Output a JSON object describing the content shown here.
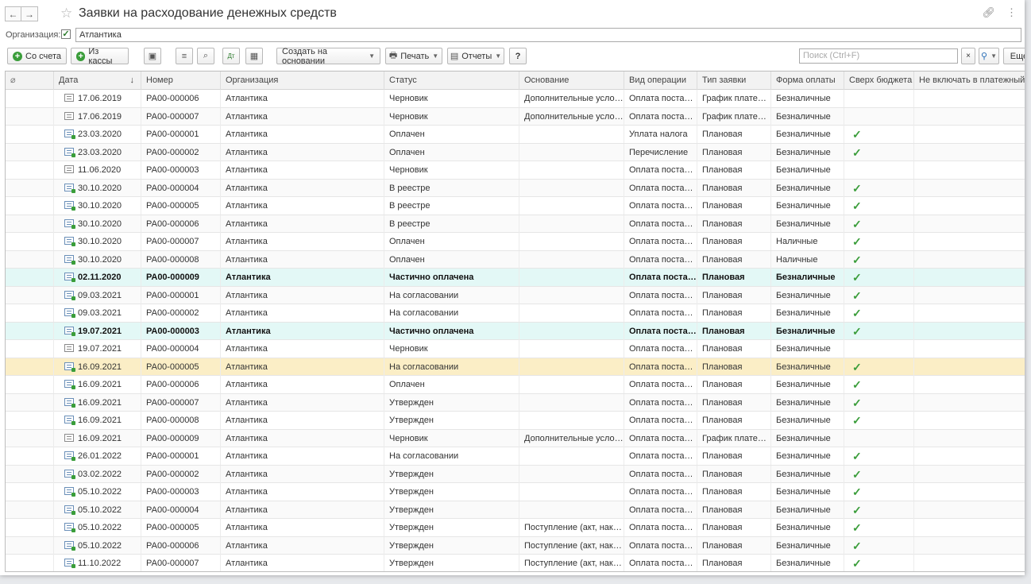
{
  "window": {
    "title": "Заявки на расходование денежных средств"
  },
  "filter": {
    "org_label": "Организация:",
    "org_value": "Атлантика"
  },
  "toolbar": {
    "from_account": "Со счета",
    "from_cash": "Из кассы",
    "create_based": "Создать на основании",
    "print": "Печать",
    "reports": "Отчеты",
    "help": "?",
    "search_placeholder": "Поиск (Ctrl+F)",
    "more": "Еще"
  },
  "columns": [
    "",
    "Дата",
    "Номер",
    "Организация",
    "Статус",
    "Основание",
    "Вид операции",
    "Тип заявки",
    "Форма оплаты",
    "Сверх бюджета",
    "Не включать в платежный ка"
  ],
  "rows": [
    {
      "posted": false,
      "date": "17.06.2019",
      "num": "РА00-000006",
      "org": "Атлантика",
      "status": "Черновик",
      "basis": "Дополнительные условия",
      "op": "Оплата поставщику",
      "type": "График платежей",
      "pay": "Безналичные",
      "over": false,
      "hl": ""
    },
    {
      "posted": false,
      "date": "17.06.2019",
      "num": "РА00-000007",
      "org": "Атлантика",
      "status": "Черновик",
      "basis": "Дополнительные условия",
      "op": "Оплата поставщику",
      "type": "График платежей",
      "pay": "Безналичные",
      "over": false,
      "hl": ""
    },
    {
      "posted": true,
      "date": "23.03.2020",
      "num": "РА00-000001",
      "org": "Атлантика",
      "status": "Оплачен",
      "basis": "",
      "op": "Уплата налога",
      "type": "Плановая",
      "pay": "Безналичные",
      "over": true,
      "hl": ""
    },
    {
      "posted": true,
      "date": "23.03.2020",
      "num": "РА00-000002",
      "org": "Атлантика",
      "status": "Оплачен",
      "basis": "",
      "op": "Перечисление",
      "type": "Плановая",
      "pay": "Безналичные",
      "over": true,
      "hl": ""
    },
    {
      "posted": false,
      "date": "11.06.2020",
      "num": "РА00-000003",
      "org": "Атлантика",
      "status": "Черновик",
      "basis": "",
      "op": "Оплата поставщику",
      "type": "Плановая",
      "pay": "Безналичные",
      "over": false,
      "hl": ""
    },
    {
      "posted": true,
      "date": "30.10.2020",
      "num": "РА00-000004",
      "org": "Атлантика",
      "status": "В реестре",
      "basis": "",
      "op": "Оплата поставщику",
      "type": "Плановая",
      "pay": "Безналичные",
      "over": true,
      "hl": ""
    },
    {
      "posted": true,
      "date": "30.10.2020",
      "num": "РА00-000005",
      "org": "Атлантика",
      "status": "В реестре",
      "basis": "",
      "op": "Оплата поставщику",
      "type": "Плановая",
      "pay": "Безналичные",
      "over": true,
      "hl": ""
    },
    {
      "posted": true,
      "date": "30.10.2020",
      "num": "РА00-000006",
      "org": "Атлантика",
      "status": "В реестре",
      "basis": "",
      "op": "Оплата поставщику",
      "type": "Плановая",
      "pay": "Безналичные",
      "over": true,
      "hl": ""
    },
    {
      "posted": true,
      "date": "30.10.2020",
      "num": "РА00-000007",
      "org": "Атлантика",
      "status": "Оплачен",
      "basis": "",
      "op": "Оплата поставщику",
      "type": "Плановая",
      "pay": "Наличные",
      "over": true,
      "hl": ""
    },
    {
      "posted": true,
      "date": "30.10.2020",
      "num": "РА00-000008",
      "org": "Атлантика",
      "status": "Оплачен",
      "basis": "",
      "op": "Оплата поставщику",
      "type": "Плановая",
      "pay": "Наличные",
      "over": true,
      "hl": ""
    },
    {
      "posted": true,
      "date": "02.11.2020",
      "num": "РА00-000009",
      "org": "Атлантика",
      "status": "Частично оплачена",
      "basis": "",
      "op": "Оплата поставщику",
      "type": "Плановая",
      "pay": "Безналичные",
      "over": true,
      "hl": "cyan"
    },
    {
      "posted": true,
      "date": "09.03.2021",
      "num": "РА00-000001",
      "org": "Атлантика",
      "status": "На согласовании",
      "basis": "",
      "op": "Оплата поставщику",
      "type": "Плановая",
      "pay": "Безналичные",
      "over": true,
      "hl": ""
    },
    {
      "posted": true,
      "date": "09.03.2021",
      "num": "РА00-000002",
      "org": "Атлантика",
      "status": "На согласовании",
      "basis": "",
      "op": "Оплата поставщику",
      "type": "Плановая",
      "pay": "Безналичные",
      "over": true,
      "hl": ""
    },
    {
      "posted": true,
      "date": "19.07.2021",
      "num": "РА00-000003",
      "org": "Атлантика",
      "status": "Частично оплачена",
      "basis": "",
      "op": "Оплата поставщику",
      "type": "Плановая",
      "pay": "Безналичные",
      "over": true,
      "hl": "cyan"
    },
    {
      "posted": false,
      "date": "19.07.2021",
      "num": "РА00-000004",
      "org": "Атлантика",
      "status": "Черновик",
      "basis": "",
      "op": "Оплата поставщику",
      "type": "Плановая",
      "pay": "Безналичные",
      "over": false,
      "hl": ""
    },
    {
      "posted": true,
      "date": "16.09.2021",
      "num": "РА00-000005",
      "org": "Атлантика",
      "status": "На согласовании",
      "basis": "",
      "op": "Оплата поставщику",
      "type": "Плановая",
      "pay": "Безналичные",
      "over": true,
      "hl": "yellow"
    },
    {
      "posted": true,
      "date": "16.09.2021",
      "num": "РА00-000006",
      "org": "Атлантика",
      "status": "Оплачен",
      "basis": "",
      "op": "Оплата поставщику",
      "type": "Плановая",
      "pay": "Безналичные",
      "over": true,
      "hl": ""
    },
    {
      "posted": true,
      "date": "16.09.2021",
      "num": "РА00-000007",
      "org": "Атлантика",
      "status": "Утвержден",
      "basis": "",
      "op": "Оплата поставщику",
      "type": "Плановая",
      "pay": "Безналичные",
      "over": true,
      "hl": ""
    },
    {
      "posted": true,
      "date": "16.09.2021",
      "num": "РА00-000008",
      "org": "Атлантика",
      "status": "Утвержден",
      "basis": "",
      "op": "Оплата поставщику",
      "type": "Плановая",
      "pay": "Безналичные",
      "over": true,
      "hl": ""
    },
    {
      "posted": false,
      "date": "16.09.2021",
      "num": "РА00-000009",
      "org": "Атлантика",
      "status": "Черновик",
      "basis": "Дополнительные условия",
      "op": "Оплата поставщику",
      "type": "График платежей",
      "pay": "Безналичные",
      "over": false,
      "hl": ""
    },
    {
      "posted": true,
      "date": "26.01.2022",
      "num": "РА00-000001",
      "org": "Атлантика",
      "status": "На согласовании",
      "basis": "",
      "op": "Оплата поставщику",
      "type": "Плановая",
      "pay": "Безналичные",
      "over": true,
      "hl": ""
    },
    {
      "posted": true,
      "date": "03.02.2022",
      "num": "РА00-000002",
      "org": "Атлантика",
      "status": "Утвержден",
      "basis": "",
      "op": "Оплата поставщику",
      "type": "Плановая",
      "pay": "Безналичные",
      "over": true,
      "hl": ""
    },
    {
      "posted": true,
      "date": "05.10.2022",
      "num": "РА00-000003",
      "org": "Атлантика",
      "status": "Утвержден",
      "basis": "",
      "op": "Оплата поставщику",
      "type": "Плановая",
      "pay": "Безналичные",
      "over": true,
      "hl": ""
    },
    {
      "posted": true,
      "date": "05.10.2022",
      "num": "РА00-000004",
      "org": "Атлантика",
      "status": "Утвержден",
      "basis": "",
      "op": "Оплата поставщику",
      "type": "Плановая",
      "pay": "Безналичные",
      "over": true,
      "hl": ""
    },
    {
      "posted": true,
      "date": "05.10.2022",
      "num": "РА00-000005",
      "org": "Атлантика",
      "status": "Утвержден",
      "basis": "Поступление (акт, накладная)",
      "op": "Оплата поставщику",
      "type": "Плановая",
      "pay": "Безналичные",
      "over": true,
      "hl": ""
    },
    {
      "posted": true,
      "date": "05.10.2022",
      "num": "РА00-000006",
      "org": "Атлантика",
      "status": "Утвержден",
      "basis": "Поступление (акт, накладная)",
      "op": "Оплата поставщику",
      "type": "Плановая",
      "pay": "Безналичные",
      "over": true,
      "hl": ""
    },
    {
      "posted": true,
      "date": "11.10.2022",
      "num": "РА00-000007",
      "org": "Атлантика",
      "status": "Утвержден",
      "basis": "Поступление (акт, накладная)",
      "op": "Оплата поставщику",
      "type": "Плановая",
      "pay": "Безналичные",
      "over": true,
      "hl": ""
    }
  ],
  "colors": {
    "accent_green": "#3a9d3a",
    "highlight_cyan": "#e3f8f6",
    "highlight_yellow": "#fbeec6"
  }
}
